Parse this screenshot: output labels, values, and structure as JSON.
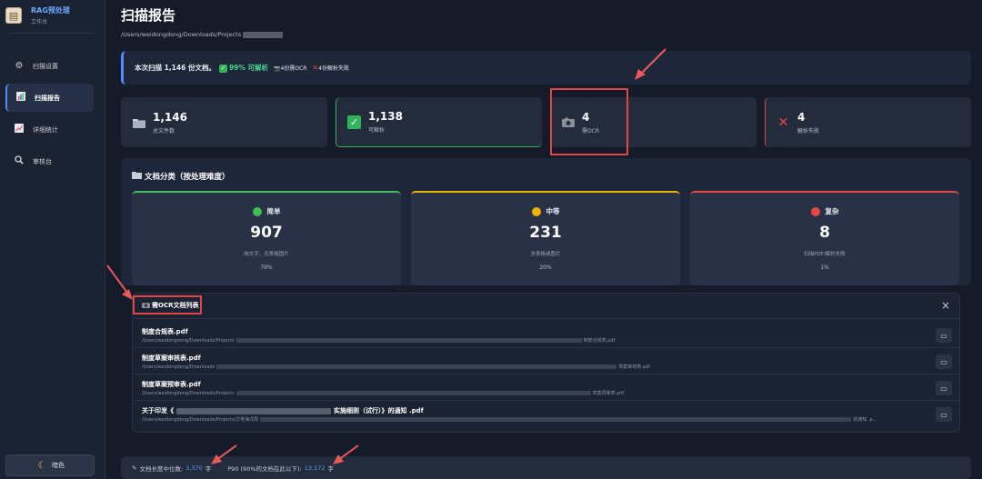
{
  "brand": {
    "title": "RAG预处理",
    "subtitle": "工作台"
  },
  "nav": [
    {
      "label": "扫描设置",
      "icon": "gear-icon"
    },
    {
      "label": "扫描报告",
      "icon": "bar-chart-icon"
    },
    {
      "label": "详细统计",
      "icon": "line-chart-icon"
    },
    {
      "label": "审核台",
      "icon": "magnifier-icon"
    }
  ],
  "theme_label": "暗色",
  "page": {
    "title": "扫描报告",
    "path": "/Users/weidongdong/Downloads/Projects"
  },
  "summary": {
    "lead": "本次扫描 1,146 份文档。",
    "ok": "99% 可解析",
    "ocr": "4份需OCR",
    "fail": "4份解析失败"
  },
  "stats": [
    {
      "value": "1,146",
      "label": "总文件数",
      "icon": "folder-icon"
    },
    {
      "value": "1,138",
      "label": "可解析",
      "icon": "check-icon"
    },
    {
      "value": "4",
      "label": "需OCR",
      "icon": "camera-icon"
    },
    {
      "value": "4",
      "label": "解析失败",
      "icon": "cross-icon"
    }
  ],
  "classification": {
    "title": "文档分类（按处理难度）",
    "tiers": [
      {
        "name": "简单",
        "count": "907",
        "desc": "纯文字、无表格图片",
        "pct": "79%",
        "color": "#3fbf5a"
      },
      {
        "name": "中等",
        "count": "231",
        "desc": "含表格或图片",
        "pct": "20%",
        "color": "#f0b400"
      },
      {
        "name": "复杂",
        "count": "8",
        "desc": "扫描PDF/解析失败",
        "pct": "1%",
        "color": "#e84545"
      }
    ]
  },
  "ocr_list": {
    "title": "需OCR文档列表",
    "close": "×",
    "rows": [
      {
        "name": "制度合规表.pdf",
        "path_start": "/Users/weidongdong/Downloads/Projects",
        "path_end": "制度合规表.pdf"
      },
      {
        "name": "制度草案审核表.pdf",
        "path_start": "/Users/weidongdong/Downloads",
        "path_end": "草案审核表.pdf"
      },
      {
        "name": "制度草案预审表.pdf",
        "path_start": "/Users/weidongdong/Downloads/Projects",
        "path_end": "草案预审表.pdf"
      },
      {
        "name_start": "关于印发《",
        "name_end": "实施细则（试行）》的通知 .pdf",
        "path_start": "/Users/weidongdong/Downloads/Projects/华电海洋局",
        "path_end": "的通知 .p..."
      }
    ]
  },
  "bottom": {
    "median_label": "文档长度中位数:",
    "median_value": "3,370",
    "unit": "字",
    "p90_label": "P90 (90%的文档在此以下):",
    "p90_value": "13,172"
  }
}
